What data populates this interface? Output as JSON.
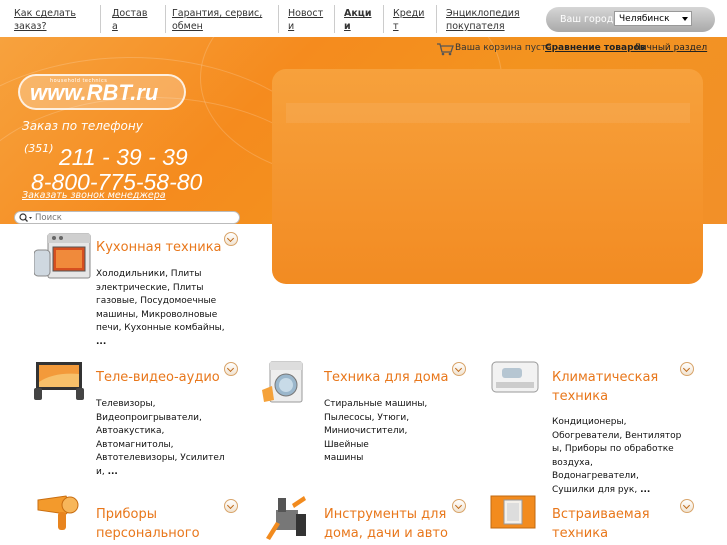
{
  "nav": {
    "items": [
      {
        "label_l1": "Как сделать",
        "label_l2": "заказ?"
      },
      {
        "label_l1": "Достав",
        "label_l2": "а"
      },
      {
        "label_l1": "Гарантия, сервис,",
        "label_l2": "обмен"
      },
      {
        "label_l1": "Новост",
        "label_l2": "и"
      },
      {
        "label_l1": "Акци",
        "label_l2": "и"
      },
      {
        "label_l1": "Креди",
        "label_l2": "т"
      },
      {
        "label_l1": "Энциклопедия",
        "label_l2": "покупателя"
      }
    ],
    "city_label": "Ваш город :",
    "city_value": "Челябинск"
  },
  "header": {
    "cart_text": "Ваша корзина пуста",
    "compare_label": "Сравнение товаров",
    "account_label": "Личный раздел",
    "logo_tag": "household technics",
    "logo_text": "www.RBT.ru",
    "order_by_phone": "Заказ по телефону",
    "area_code": "(351)",
    "phone1": "211 - 39 - 39",
    "phone2": "8-800-775-58-80",
    "callback_label": "Заказать звонок менеджера",
    "search_placeholder": "Поиск"
  },
  "categories": [
    {
      "title_l1": "Кухонная техника",
      "title_l2": "",
      "desc": [
        "Холодильники, Плиты",
        "электрические, Плиты",
        "газовые, Посудомоечные",
        "машины, Микроволновые",
        "печи, Кухонные комбайны,"
      ],
      "more": "..."
    },
    {
      "title_l1": "Теле-видео-аудио",
      "title_l2": "",
      "desc": [
        "Телевизоры,",
        "Видеопроигрыватели,",
        "Автоакустика,",
        "Автомагнитолы,",
        "Автотелевизоры, Усилител",
        "и,"
      ],
      "more": "..."
    },
    {
      "title_l1": "Техника для дома",
      "title_l2": "",
      "desc": [
        "Стиральные машины,",
        "Пылесосы, Утюги,",
        "Миниочистители, Швейные",
        "машины"
      ],
      "more": ""
    },
    {
      "title_l1": "Климатическая",
      "title_l2": "техника",
      "desc": [
        "Кондиционеры,",
        "Обогреватели, Вентилятор",
        "ы, Приборы по обработке",
        "воздуха, Водонагреватели,",
        "Сушилки для рук,"
      ],
      "more": "..."
    },
    {
      "title_l1": "Приборы",
      "title_l2": "персонального",
      "desc": [],
      "more": ""
    },
    {
      "title_l1": "Инструменты для",
      "title_l2": "дома, дачи и авто",
      "desc": [],
      "more": ""
    },
    {
      "title_l1": "Встраиваемая",
      "title_l2": "техника",
      "desc": [],
      "more": ""
    }
  ],
  "icons": [
    "cart-icon",
    "search-icon",
    "stove-icon",
    "tv-icon",
    "washing-machine-icon",
    "air-conditioner-icon",
    "hair-dryer-icon",
    "tools-icon",
    "built-in-oven-icon"
  ],
  "colors": {
    "accent": "#f58b1e",
    "category_title": "#e8771b"
  }
}
